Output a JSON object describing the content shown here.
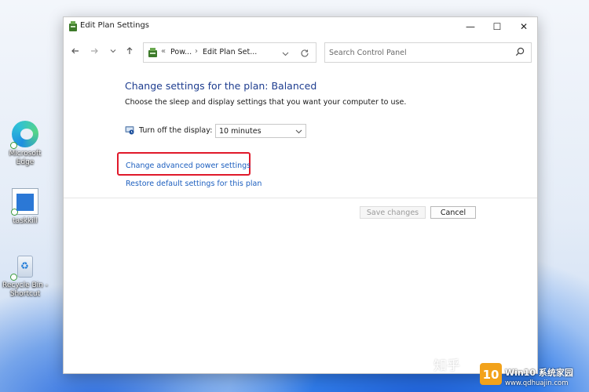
{
  "window": {
    "title": "Edit Plan Settings",
    "controls": {
      "minimize": "—",
      "maximize": "☐",
      "close": "✕"
    }
  },
  "nav": {
    "back_icon": "back-arrow-icon",
    "forward_icon": "forward-arrow-icon",
    "recent_icon": "chevron-down-icon",
    "up_icon": "up-arrow-icon",
    "breadcrumb": {
      "overflow": "«",
      "items": [
        "Pow...",
        "Edit Plan Set..."
      ],
      "separator": "›"
    },
    "search": {
      "placeholder": "Search Control Panel",
      "value": ""
    }
  },
  "main": {
    "heading": "Change settings for the plan: Balanced",
    "subtext": "Choose the sleep and display settings that you want your computer to use.",
    "display_setting": {
      "label": "Turn off the display:",
      "value": "10 minutes"
    },
    "links": {
      "advanced": "Change advanced power settings",
      "restore": "Restore default settings for this plan"
    },
    "buttons": {
      "save": "Save changes",
      "cancel": "Cancel"
    }
  },
  "desktop": {
    "icons": [
      {
        "label": "Microsoft Edge"
      },
      {
        "label": "taskkill"
      },
      {
        "label": "Recycle Bin - Shortcut"
      }
    ]
  },
  "watermark": {
    "zhihu": "知乎",
    "badge": "10",
    "site_name": "Win10 系统家园",
    "url": "www.qdhuajin.com"
  },
  "colors": {
    "heading": "#1e3d8f",
    "link": "#1d5fbf",
    "highlight_box": "#e0192a",
    "wallpaper_accent": "#2f7ae8"
  }
}
